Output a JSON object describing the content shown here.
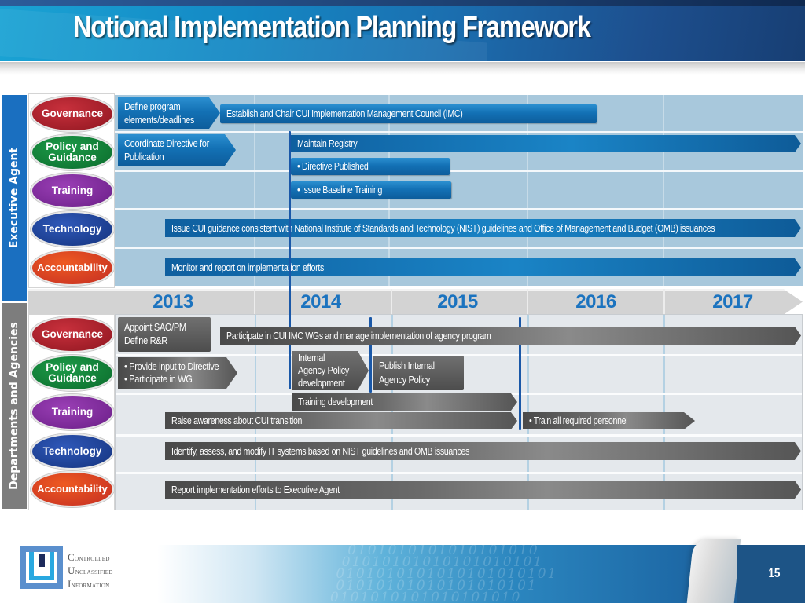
{
  "title": "Notional Implementation Planning Framework",
  "side_labels": {
    "executive": "Executive Agent",
    "departments": "Departments and Agencies"
  },
  "categories": {
    "executive": [
      "Governance",
      "Policy and Guidance",
      "Training",
      "Technology",
      "Accountability"
    ],
    "departments": [
      "Governance",
      "Policy and Guidance",
      "Training",
      "Technology",
      "Accountability"
    ]
  },
  "years": [
    "2013",
    "2014",
    "2015",
    "2016",
    "2017"
  ],
  "executive_tasks": {
    "governance": [
      "Define program elements/deadlines",
      "Establish and Chair CUI Implementation Management Council (IMC)"
    ],
    "policy": [
      "Coordinate Directive for Publication",
      "Maintain Registry",
      "• Directive Published"
    ],
    "training": [
      "• Issue Baseline Training"
    ],
    "technology": [
      "Issue CUI guidance consistent with National Institute of Standards and Technology (NIST) guidelines and Office of Management and Budget (OMB) issuances"
    ],
    "accountability": [
      "Monitor and report on implementation efforts"
    ]
  },
  "department_tasks": {
    "governance": [
      "Appoint SAO/PM",
      "Define R&R",
      "Participate in CUI IMC WGs and manage implementation of agency program"
    ],
    "policy": [
      "• Provide input to Directive",
      "• Participate in WG",
      "Internal",
      "Agency Policy",
      "development",
      "Publish Internal",
      "Agency Policy"
    ],
    "training": [
      "Training development",
      "Raise awareness about CUI transition",
      "• Train all required personnel"
    ],
    "technology": [
      "Identify, assess, and modify IT systems based on NIST guidelines and OMB issuances"
    ],
    "accountability": [
      "Report implementation efforts to Executive Agent"
    ]
  },
  "footer": {
    "logo_lines": [
      "Controlled",
      "Unclassified",
      "Information"
    ],
    "page_number": "15"
  },
  "colors": {
    "governance": "#a51d2a",
    "policy": "#138a3c",
    "training": "#7f2ea0",
    "technology": "#1f4599",
    "accountability": "#d9411f",
    "executive_bar": "#1371b5",
    "department_bar": "#5a5a5a",
    "year_text": "#1b73bf"
  }
}
